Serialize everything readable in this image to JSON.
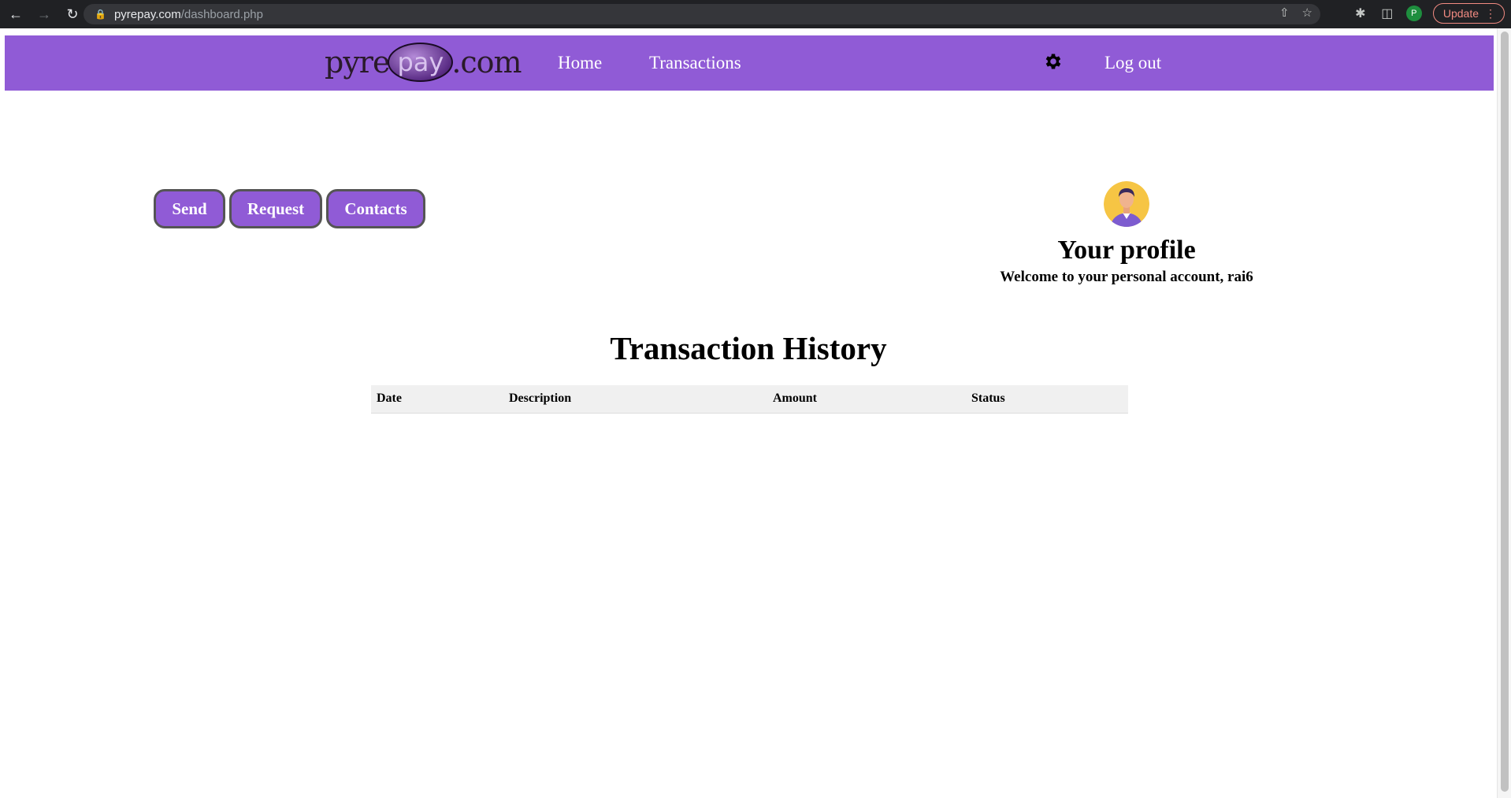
{
  "browser": {
    "url_host": "pyrepay.com",
    "url_path": "/dashboard.php",
    "update_label": "Update",
    "profile_initial": "P"
  },
  "header": {
    "logo": {
      "part1": "pyre",
      "part2": "pay",
      "part3": ".com"
    },
    "nav": {
      "home": "Home",
      "transactions": "Transactions",
      "logout": "Log out"
    }
  },
  "actions": {
    "send": "Send",
    "request": "Request",
    "contacts": "Contacts"
  },
  "profile": {
    "title": "Your profile",
    "welcome": "Welcome to your personal account, rai6"
  },
  "history": {
    "title": "Transaction History",
    "columns": [
      "Date",
      "Description",
      "Amount",
      "Status"
    ],
    "rows": []
  },
  "colors": {
    "brand_purple": "#905bd6"
  }
}
